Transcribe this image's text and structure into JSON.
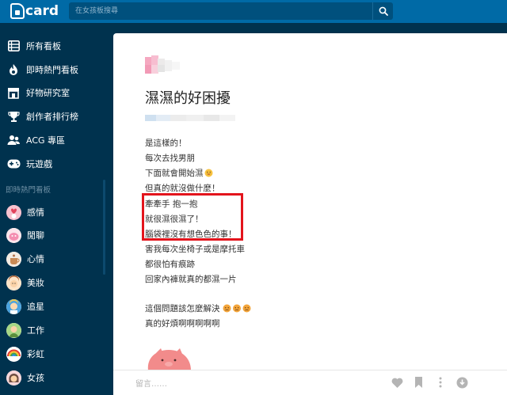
{
  "header": {
    "logo_text": "card",
    "search_placeholder": "在女孩板搜尋"
  },
  "sidebar": {
    "main_items": [
      {
        "label": "所有看板",
        "icon": "list-icon"
      },
      {
        "label": "即時熱門看板",
        "icon": "fire-icon"
      },
      {
        "label": "好物研究室",
        "icon": "store-icon"
      },
      {
        "label": "創作者排行榜",
        "icon": "trophy-icon"
      },
      {
        "label": "ACG 專區",
        "icon": "users-icon"
      },
      {
        "label": "玩遊戲",
        "icon": "gamepad-icon"
      }
    ],
    "section_title": "即時熱門看板",
    "boards": [
      {
        "label": "感情"
      },
      {
        "label": "閒聊"
      },
      {
        "label": "心情"
      },
      {
        "label": "美妝"
      },
      {
        "label": "追星"
      },
      {
        "label": "工作"
      },
      {
        "label": "彩虹"
      },
      {
        "label": "女孩"
      }
    ]
  },
  "post": {
    "title": "濕濕的好困擾",
    "lines": [
      "是這樣的！",
      "每次去找男朋",
      "下面就會開始濕",
      "但真的就沒做什麼！",
      "牽牽手 抱一抱",
      "就很濕很濕了！",
      "腦袋裡沒有想色色的事！",
      "害我每次坐椅子或是摩托車",
      "都很怕有痕跡",
      "回家內褲就真的都濕一片",
      "這個問題該怎麼解決",
      "真的好煩啊啊啊啊啊"
    ],
    "comment_placeholder": "留言……"
  },
  "colors": {
    "topbar": "#006aa6",
    "sidebar": "#00324e",
    "highlight_box": "#e3141c"
  }
}
